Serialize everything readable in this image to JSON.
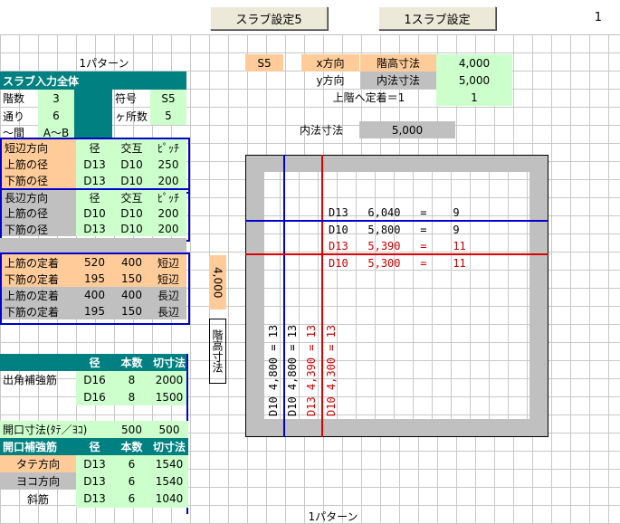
{
  "toolbar": {
    "button1": "スラブ設定5",
    "button2": "1スラブ設定",
    "page_number": "1"
  },
  "pattern_label": "1パターン",
  "bottom_label": "1パターン",
  "input": {
    "title": "スラブ入力全体",
    "floors_label": "階数",
    "floors_value": "3",
    "symbol_label": "符号",
    "symbol_value": "S5",
    "axis_label": "通り",
    "axis_value": "6",
    "count_label": "ヶ所数",
    "count_value": "5",
    "span_label": "～間",
    "span_value": "A～B"
  },
  "short": {
    "head": [
      "短辺方向",
      "径",
      "交互",
      "ﾋﾟｯﾁ"
    ],
    "upper": [
      "上筋の径",
      "D13",
      "D10",
      "250"
    ],
    "lower": [
      "下筋の径",
      "D13",
      "D10",
      "200"
    ]
  },
  "long": {
    "head": [
      "長辺方向",
      "径",
      "交互",
      "ﾋﾟｯﾁ"
    ],
    "upper": [
      "上筋の径",
      "D10",
      "D10",
      "200"
    ],
    "lower": [
      "下筋の径",
      "D13",
      "D10",
      "200"
    ]
  },
  "anchor": [
    [
      "上筋の定着",
      "520",
      "400",
      "短辺"
    ],
    [
      "下筋の定着",
      "195",
      "150",
      "短辺"
    ],
    [
      "上筋の定着",
      "400",
      "400",
      "長辺"
    ],
    [
      "下筋の定着",
      "195",
      "150",
      "長辺"
    ]
  ],
  "corner": {
    "head": [
      "径",
      "本数",
      "切寸法"
    ],
    "label": "出角補強筋",
    "rows": [
      [
        "D16",
        "8",
        "2000"
      ],
      [
        "D16",
        "8",
        "1500"
      ]
    ]
  },
  "opening": {
    "size_label": "開口寸法(ﾀﾃ／ﾖｺ)",
    "size_v": "500",
    "size_h": "500",
    "head": [
      "開口補強筋",
      "径",
      "本数",
      "切寸法"
    ],
    "rows": [
      [
        "タテ方向",
        "D13",
        "6",
        "1540"
      ],
      [
        "ヨコ方向",
        "D13",
        "6",
        "1540"
      ],
      [
        "斜筋",
        "D13",
        "6",
        "1040"
      ]
    ]
  },
  "info": {
    "slab": "S5",
    "x_label": "x方向",
    "x_name": "階高寸法",
    "x_value": "4,000",
    "y_label": "y方向",
    "y_name": "内法寸法",
    "y_value": "5,000",
    "upper_label": "上階へ定着＝1",
    "upper_value": "1",
    "inner_label": "内法寸法",
    "inner_value": "5,000"
  },
  "floor_height": {
    "label": "階高寸法",
    "value": "4,000"
  },
  "diagram": {
    "h": [
      {
        "d": "D13",
        "len": "6,040",
        "eq": "=",
        "n": "9"
      },
      {
        "d": "D10",
        "len": "5,800",
        "eq": "=",
        "n": "9"
      },
      {
        "d": "D13",
        "len": "5,390",
        "eq": "=",
        "n": "11"
      },
      {
        "d": "D10",
        "len": "5,300",
        "eq": "=",
        "n": "11"
      }
    ],
    "v": [
      "D10  4,800  =  13",
      "D10  4,800  =  13",
      "D13  4,390  =  13",
      "D10  4,300  =  13"
    ],
    "colors": {
      "blue": "#0000cc",
      "red": "#dd0000",
      "frame": "#c0c0c0"
    }
  }
}
